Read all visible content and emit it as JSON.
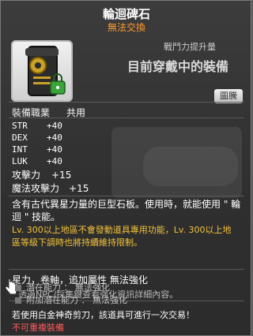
{
  "item": {
    "name": "輪迴碑石",
    "trade_status": "無法交換",
    "power_up_label": "戰鬥力提升量",
    "equipped_label": "目前穿戴中的裝備",
    "illustration_button": "圖騰"
  },
  "requirements": {
    "job_label": "裝備職業",
    "job_value": "共用"
  },
  "stats": [
    {
      "name": "STR",
      "value": "+40"
    },
    {
      "name": "DEX",
      "value": "+40"
    },
    {
      "name": "INT",
      "value": "+40"
    },
    {
      "name": "LUK",
      "value": "+40"
    }
  ],
  "attack": {
    "label": "攻擊力",
    "value": "+15"
  },
  "magic_attack": {
    "label": "魔法攻擊力",
    "value": "+15"
  },
  "description": {
    "line1": "含有古代異星力量的巨型石板。使用時，就能使用 \" 輪",
    "line2": "迴 \" 技能。",
    "gold1": "Lv. 300以上地區不會發動道具專用功能，Lv. 300以上地",
    "gold2": "區等級下調時也將持續維持限制。"
  },
  "flags": {
    "text": "星力，卷軸，追加屬性 無法強化",
    "sub": "透過NPC/採集鍵查看強化資訊詳細內容。"
  },
  "potential": {
    "line1": "潛在能力 ： 無法強化",
    "line2": "附加潛在能力 ： 無法強化"
  },
  "footer": {
    "line1": "若使用白金神奇剪刀，該道具可進行一次交易！",
    "line2": "不可重複裝備"
  },
  "colors": {
    "trade_status": "#ff9a2e",
    "gold_text": "#f2c23a",
    "warning": "#ff5a5a"
  }
}
